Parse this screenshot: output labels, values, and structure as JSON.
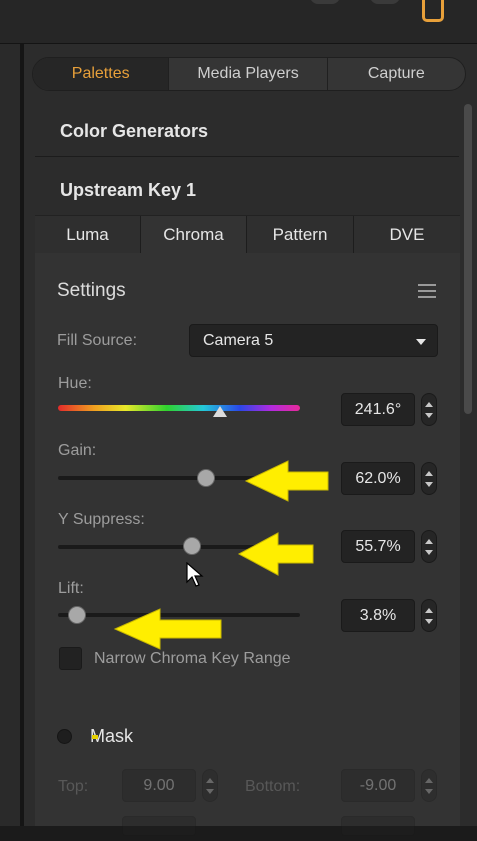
{
  "main_tabs": [
    "Palettes",
    "Media Players",
    "Capture"
  ],
  "sections": {
    "color_generators": "Color Generators",
    "upstream_key": "Upstream Key 1"
  },
  "key_tabs": [
    "Luma",
    "Chroma",
    "Pattern",
    "DVE"
  ],
  "settings": {
    "title": "Settings",
    "fill_source_label": "Fill Source:",
    "fill_source_value": "Camera 5",
    "hue_label": "Hue:",
    "hue_value": "241.6°",
    "gain_label": "Gain:",
    "gain_value": "62.0%",
    "y_suppress_label": "Y Suppress:",
    "y_suppress_value": "55.7%",
    "lift_label": "Lift:",
    "lift_value": "3.8%",
    "narrow_label": "Narrow Chroma Key Range"
  },
  "mask": {
    "label": "Mask",
    "top_label": "Top:",
    "top_value": "9.00",
    "bottom_label": "Bottom:",
    "bottom_value": "-9.00"
  },
  "colors": {
    "accent": "#e8a03a",
    "annotation_arrow": "#ffee00"
  },
  "icons": [
    "menu-icon",
    "dropdown-caret-icon",
    "stepper-icon",
    "mouse-pointer-icon",
    "annotation-arrow-icon"
  ]
}
